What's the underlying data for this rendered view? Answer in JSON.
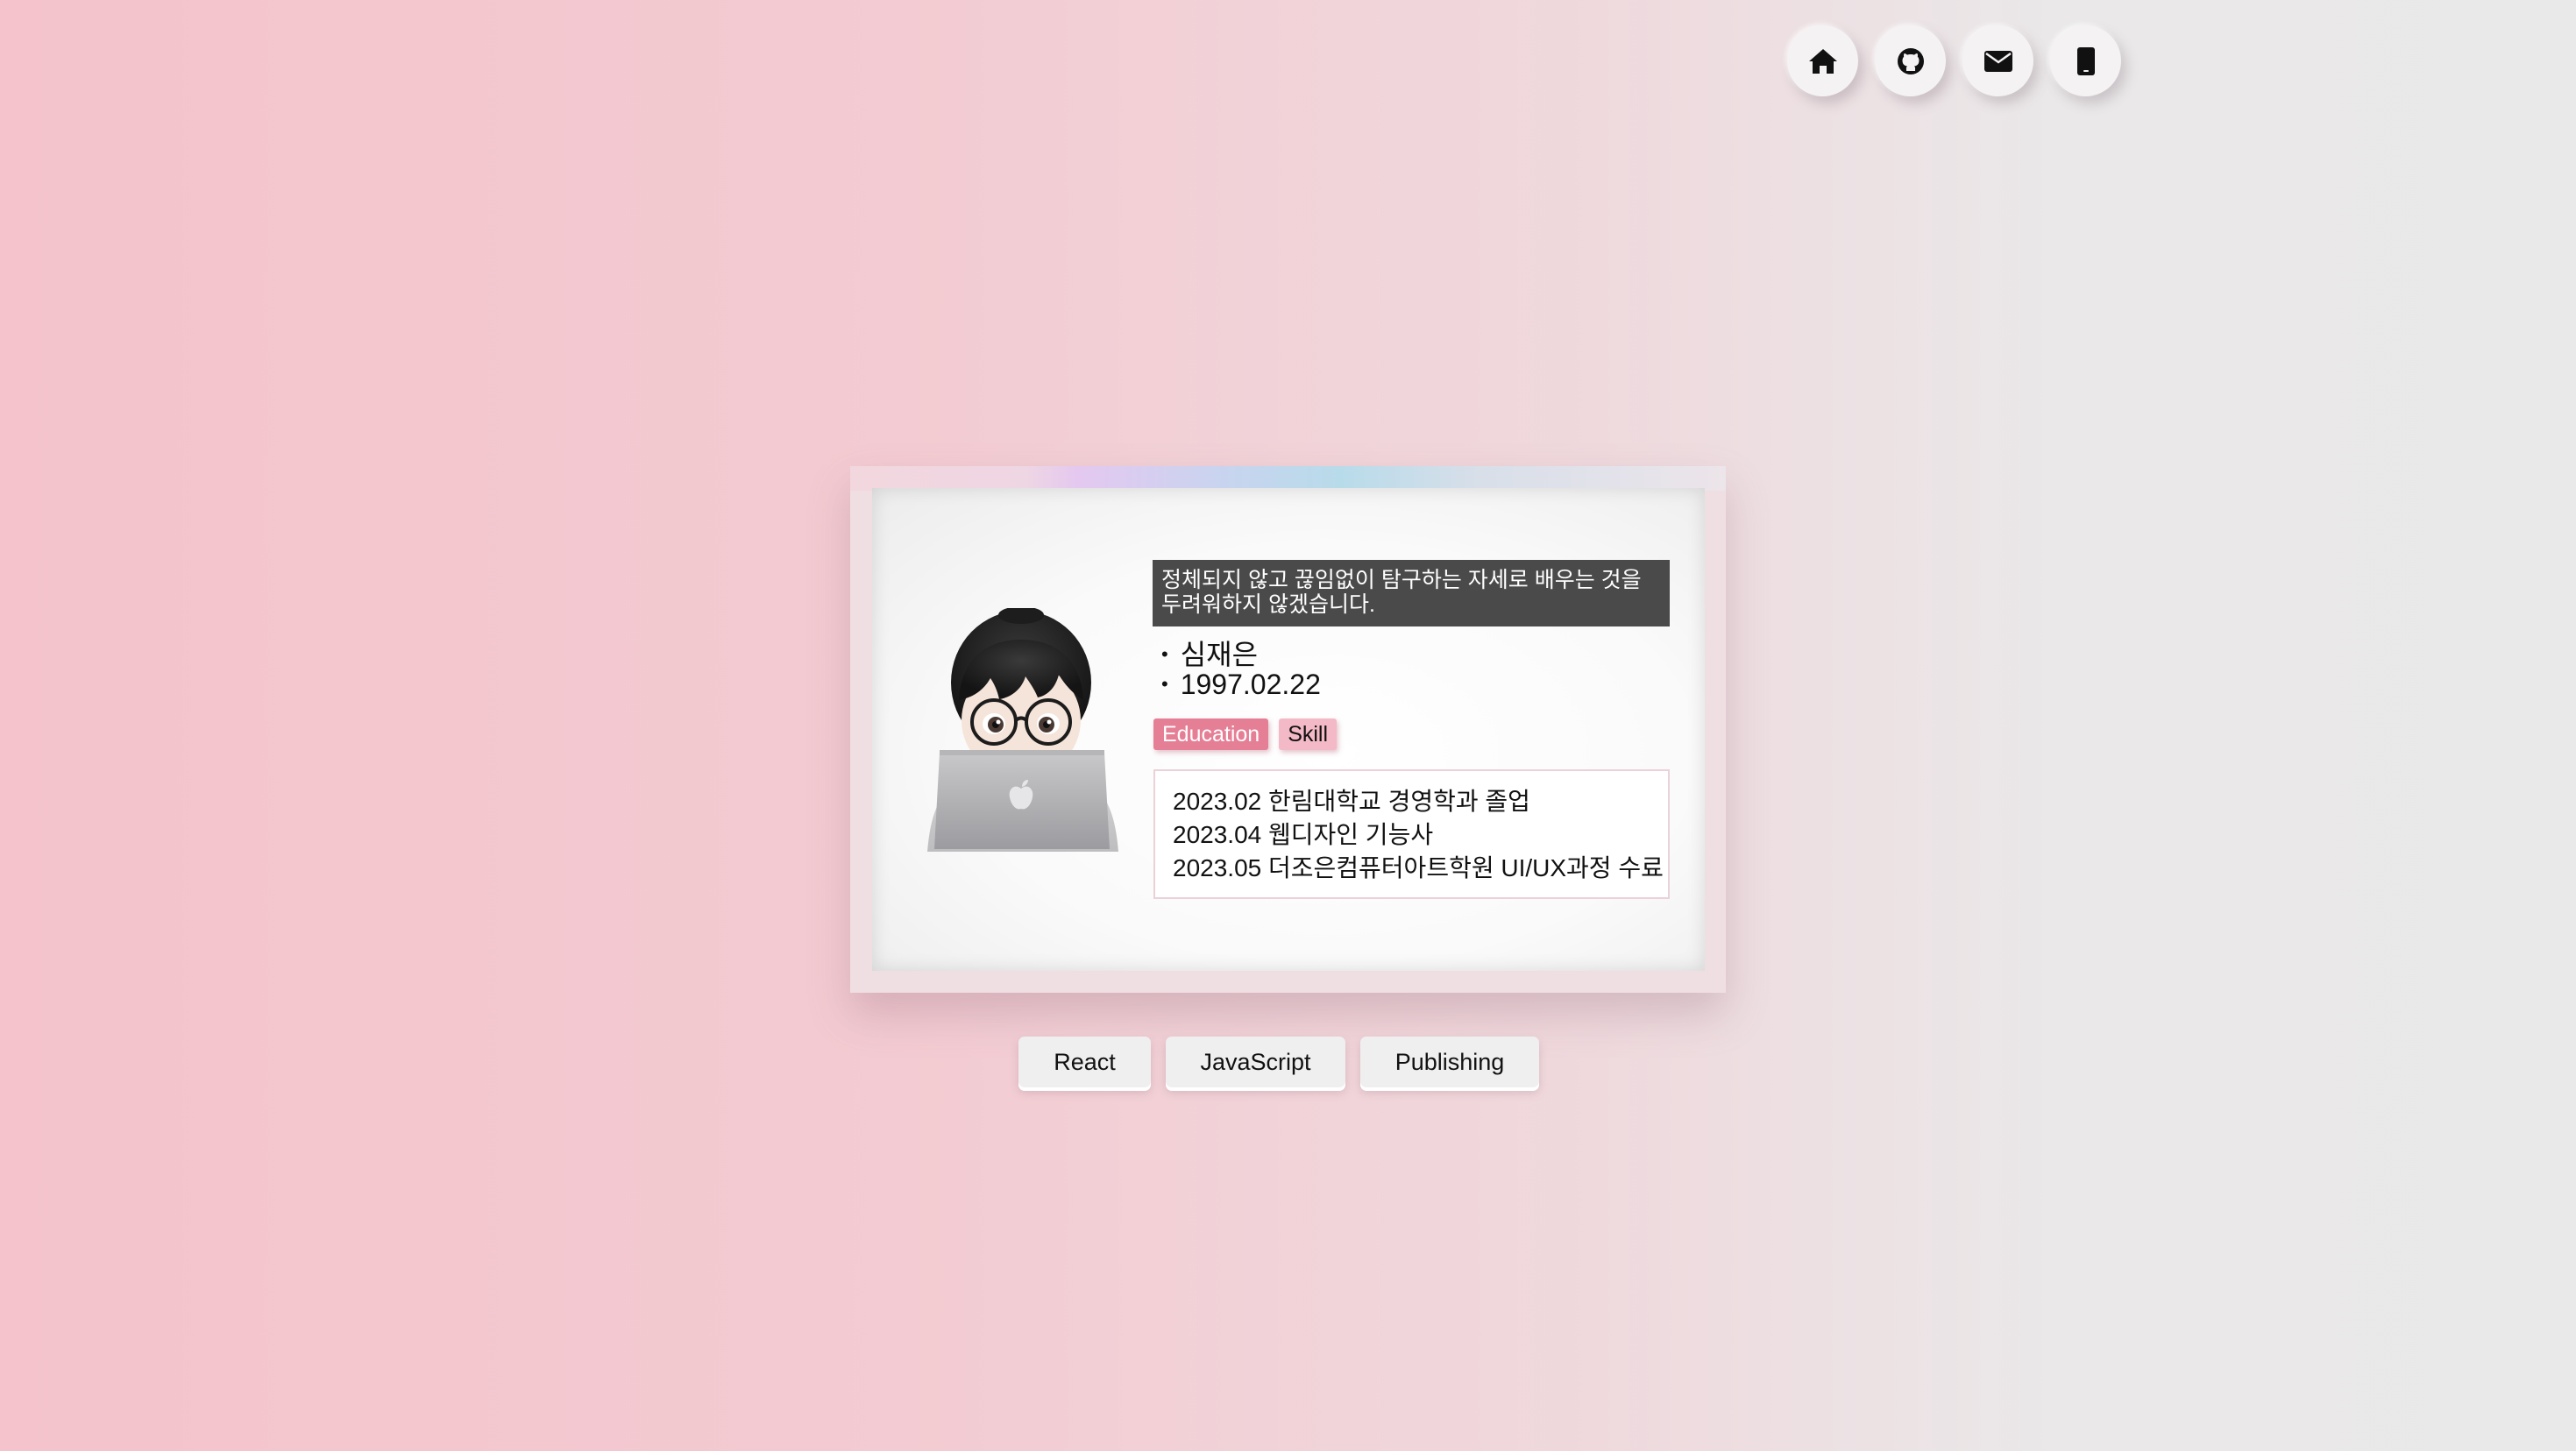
{
  "nav": {
    "icons": [
      "home-icon",
      "github-icon",
      "mail-icon",
      "phone-icon"
    ]
  },
  "profile": {
    "motto": "정체되지 않고 끊임없이 탐구하는 자세로 배우는 것을 두려워하지 않겠습니다.",
    "name": "심재은",
    "birth": "1997.02.22"
  },
  "tabs": {
    "education": "Education",
    "skill": "Skill",
    "active": "Education"
  },
  "education": {
    "items": [
      "2023.02 한림대학교 경영학과 졸업",
      "2023.04 웹디자인 기능사",
      "2023.05 더조은컴퓨터아트학원 UI/UX과정 수료"
    ]
  },
  "buttons": {
    "react": "React",
    "javascript": "JavaScript",
    "publishing": "Publishing"
  },
  "colors": {
    "accent": "#e57f96",
    "accent_light": "#f3b9c6",
    "motto_bg": "#4a4a4a"
  }
}
